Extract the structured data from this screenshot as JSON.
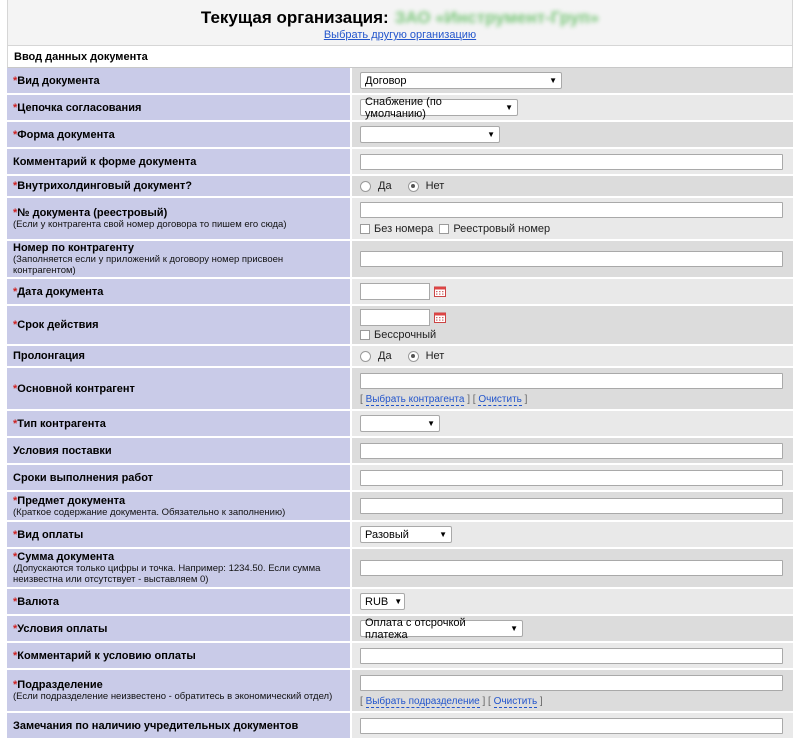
{
  "header": {
    "title": "Текущая организация:",
    "org_name": "ЗАО «Инструмент-Груп»",
    "change_link": "Выбрать другую организацию"
  },
  "section_title": "Ввод данных документа",
  "fields": {
    "doc_type": {
      "label": "Вид документа",
      "value": "Договор"
    },
    "chain": {
      "label": "Цепочка согласования",
      "value": "Снабжение (по умолчанию)"
    },
    "doc_form": {
      "label": "Форма документа",
      "value": ""
    },
    "form_comment": {
      "label": "Комментарий к форме документа",
      "value": ""
    },
    "intra": {
      "label": "Внутрихолдинговый документ?",
      "yes": "Да",
      "no": "Нет"
    },
    "doc_number": {
      "label": "№ документа (реестровый)",
      "hint": "(Если у контрагента свой номер договора то пишем его сюда)",
      "no_number": "Без номера",
      "registry_number": "Реестровый номер"
    },
    "counterparty_number": {
      "label": "Номер по контрагенту",
      "hint": "(Заполняется если у приложений к договору номер присвоен контрагентом)"
    },
    "doc_date": {
      "label": "Дата документа"
    },
    "validity": {
      "label": "Срок действия",
      "unlimited": "Бессрочный"
    },
    "prolongation": {
      "label": "Пролонгация",
      "yes": "Да",
      "no": "Нет"
    },
    "main_counterparty": {
      "label": "Основной контрагент",
      "select_link": "Выбрать контрагента",
      "clear_link": "Очистить"
    },
    "counterparty_type": {
      "label": "Тип контрагента",
      "value": ""
    },
    "delivery_terms": {
      "label": "Условия поставки"
    },
    "work_terms": {
      "label": "Сроки выполнения работ"
    },
    "subject": {
      "label": "Предмет документа",
      "hint": "(Краткое содержание документа. Обязательно к заполнению)"
    },
    "payment_type": {
      "label": "Вид оплаты",
      "value": "Разовый"
    },
    "amount": {
      "label": "Сумма документа",
      "hint": "(Допускаются только цифры и точка. Например: 1234.50. Если сумма неизвестна или отсутствует - выставляем 0)"
    },
    "currency": {
      "label": "Валюта",
      "value": "RUB"
    },
    "payment_terms": {
      "label": "Условия оплаты",
      "value": "Оплата с отсрочкой платежа"
    },
    "payment_comment": {
      "label": "Комментарий к условию оплаты"
    },
    "department": {
      "label": "Подразделение",
      "hint": "(Если подразделение неизвестено - обратитесь в экономический отдел)",
      "select_link": "Выбрать подразделение",
      "clear_link": "Очистить"
    },
    "founding_docs": {
      "label": "Замечания по наличию учредительных документов"
    }
  },
  "icons": {
    "calendar": "calendar-icon",
    "dropdown": "chevron-down-icon"
  },
  "colors": {
    "label_bg": "#c9cbe8",
    "required": "#cc2222",
    "link": "#2255cc"
  }
}
